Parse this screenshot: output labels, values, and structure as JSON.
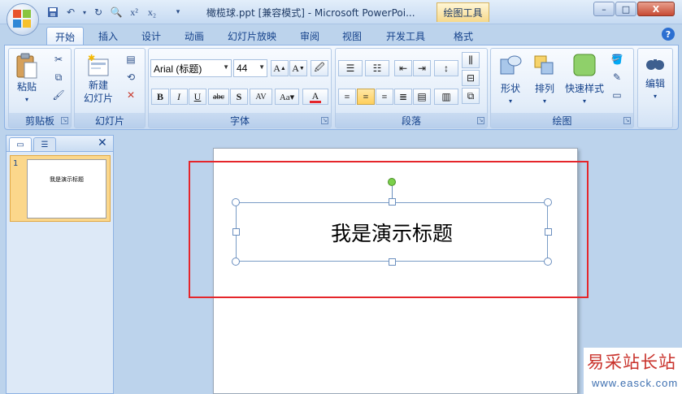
{
  "window": {
    "title": "橄榄球.ppt [兼容模式] - Microsoft PowerPoi...",
    "context_tab": "绘图工具",
    "minimize": "–",
    "maximize": "□",
    "close": "X"
  },
  "qat": [
    "save-icon",
    "undo-icon",
    "redo-icon",
    "print-preview-icon",
    "superscript-icon",
    "subscript-icon",
    "customize-icon"
  ],
  "tabs": [
    {
      "label": "开始",
      "active": true
    },
    {
      "label": "插入"
    },
    {
      "label": "设计"
    },
    {
      "label": "动画"
    },
    {
      "label": "幻灯片放映"
    },
    {
      "label": "审阅"
    },
    {
      "label": "视图"
    },
    {
      "label": "开发工具"
    },
    {
      "label": "格式"
    }
  ],
  "ribbon": {
    "clipboard": {
      "label": "剪贴板",
      "paste": "粘贴"
    },
    "slides": {
      "label": "幻灯片",
      "new_slide_line1": "新建",
      "new_slide_line2": "幻灯片"
    },
    "font": {
      "label": "字体",
      "font_name": "Arial (标题)",
      "font_size": "44"
    },
    "paragraph": {
      "label": "段落"
    },
    "drawing": {
      "label": "绘图",
      "shapes": "形状",
      "arrange": "排列",
      "quick_styles": "快速样式"
    },
    "editing": {
      "label": "编辑"
    }
  },
  "slide_panel": {
    "thumb_number": "1",
    "thumb_title": "我是演示标题"
  },
  "slide": {
    "title": "我是演示标题"
  },
  "watermark": {
    "text": "易采站长站",
    "url": "www.easck.com"
  },
  "colors": {
    "accent": "#15428b",
    "highlight_box": "#e5262b",
    "font_color_bar": "#e5262b"
  }
}
